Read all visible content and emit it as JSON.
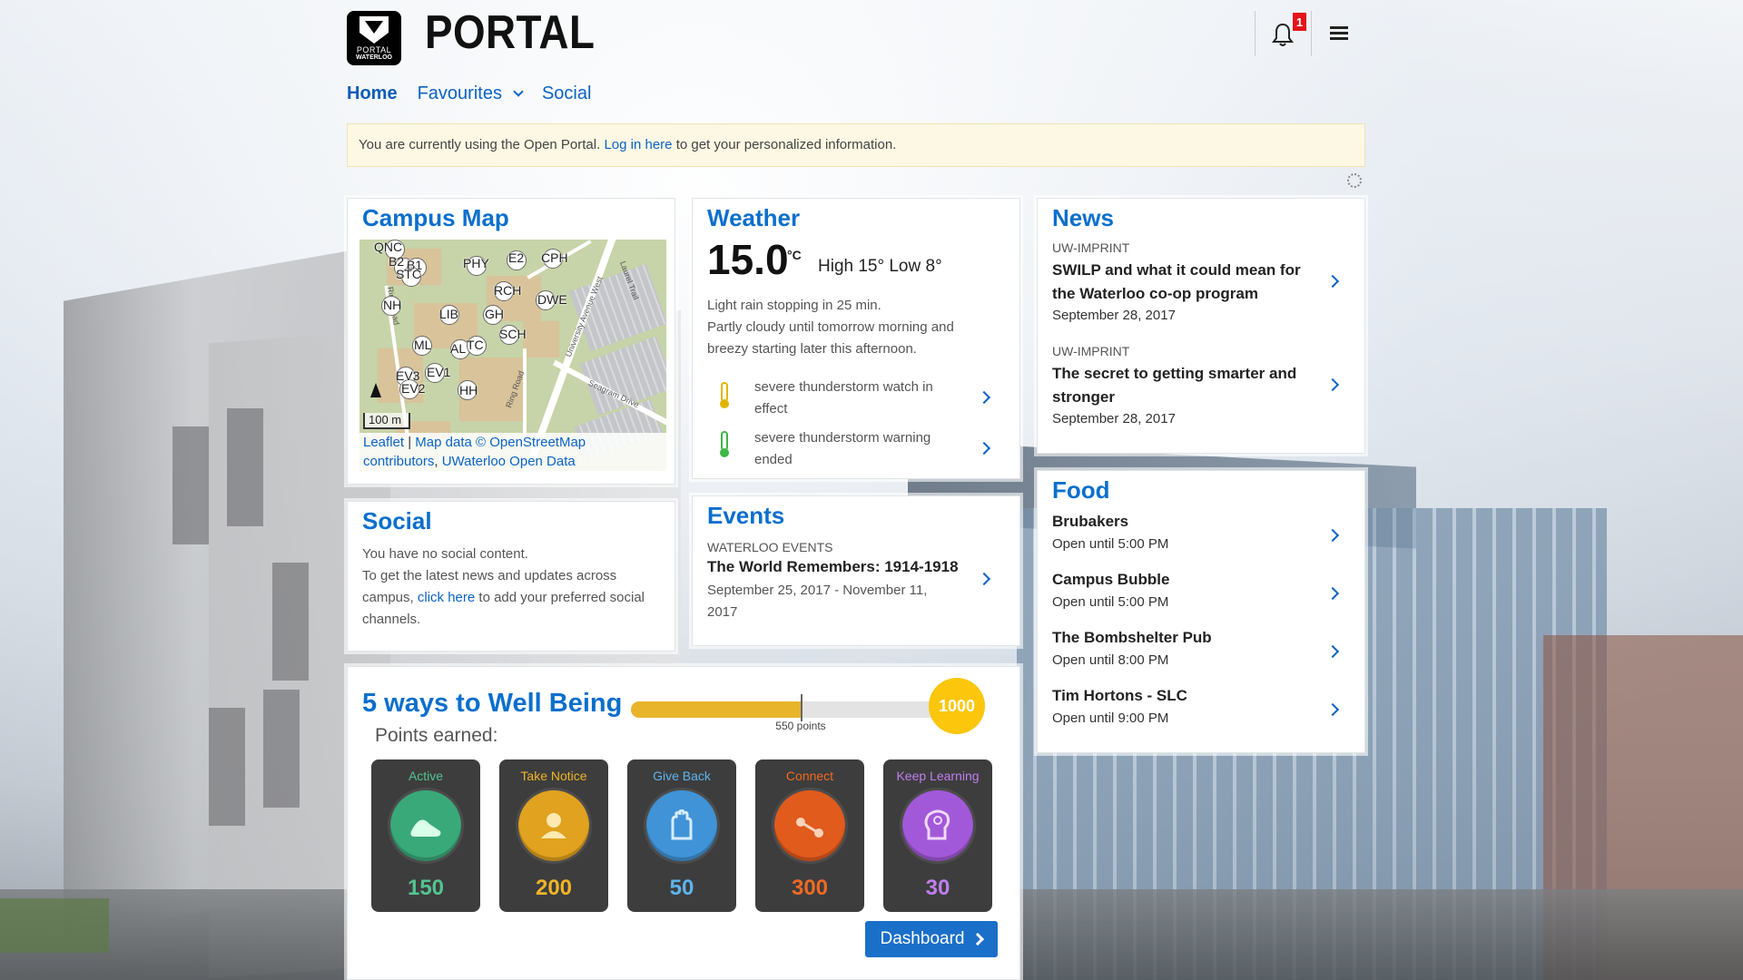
{
  "header": {
    "logo_text_1": "PORTAL",
    "logo_text_2": "WATERLOO",
    "title": "PORTAL",
    "notification_count": "1"
  },
  "nav": {
    "home": "Home",
    "favourites": "Favourites",
    "social": "Social"
  },
  "notice": {
    "before": "You are currently using the Open Portal.",
    "link": "Log in here",
    "after": "to get your personalized information."
  },
  "campus_map": {
    "title": "Campus Map",
    "pins": [
      "QNC",
      "B2",
      "B1",
      "STC",
      "PHY",
      "E2",
      "CPH",
      "RCH",
      "DWE",
      "NH",
      "LIB",
      "GH",
      "SCH",
      "ML",
      "AL",
      "TC",
      "EV1",
      "EV3",
      "EV2",
      "HH"
    ],
    "streets": [
      "University Avenue West",
      "Ring Road",
      "Ring Road",
      "Seagram Drive",
      "Laurel Trail"
    ],
    "scale": "100 m",
    "attrib_leaflet": "Leaflet",
    "attrib_sep": "|",
    "attrib_map": "Map data ©",
    "attrib_osm": "OpenStreetMap contributors",
    "attrib_comma": ",",
    "attrib_uw": "UWaterloo Open Data"
  },
  "weather": {
    "title": "Weather",
    "temp": "15.0",
    "unit": "°C",
    "hilo": "High 15° Low 8°",
    "desc_1": "Light rain stopping in 25 min.",
    "desc_2": "Partly cloudy until tomorrow morning and breezy starting later this afternoon.",
    "alerts": [
      {
        "text": "severe thunderstorm watch in effect",
        "color": "#e1b400"
      },
      {
        "text": "severe thunderstorm warning ended",
        "color": "#3db843"
      }
    ]
  },
  "news": {
    "title": "News",
    "items": [
      {
        "source": "UW-IMPRINT",
        "headline": "SWILP and what it could mean for the Waterloo co-op program",
        "date": "September 28, 2017"
      },
      {
        "source": "UW-IMPRINT",
        "headline": "The secret to getting smarter and stronger",
        "date": "September 28, 2017"
      }
    ]
  },
  "social": {
    "title": "Social",
    "line_1": "You have no social content.",
    "line_2_before": "To get the latest news and updates across campus,",
    "link": "click here",
    "line_2_after": "to add your preferred social channels."
  },
  "events": {
    "title": "Events",
    "source": "WATERLOO EVENTS",
    "name": "The World Remembers: 1914-1918",
    "dates": "September 25, 2017 - November 11, 2017"
  },
  "food": {
    "title": "Food",
    "items": [
      {
        "name": "Brubakers",
        "hours": "Open until 5:00 PM"
      },
      {
        "name": "Campus Bubble",
        "hours": "Open until 5:00 PM"
      },
      {
        "name": "The Bombshelter Pub",
        "hours": "Open until 8:00 PM"
      },
      {
        "name": "Tim Hortons - SLC",
        "hours": "Open until 9:00 PM"
      }
    ]
  },
  "wellbeing": {
    "title": "5 ways to Well Being",
    "points_label": "Points earned:",
    "progress_points": 550,
    "goal": "1000",
    "progress_label": "550 points",
    "categories": [
      {
        "label": "Active",
        "value": "150",
        "color": "#3aa97a",
        "label_color": "#53c48f"
      },
      {
        "label": "Take Notice",
        "value": "200",
        "color": "#e0a21f",
        "label_color": "#f0b428"
      },
      {
        "label": "Give Back",
        "value": "50",
        "color": "#3f93d6",
        "label_color": "#5eb3ee"
      },
      {
        "label": "Connect",
        "value": "300",
        "color": "#e05b1c",
        "label_color": "#ef6a22"
      },
      {
        "label": "Keep Learning",
        "value": "30",
        "color": "#a259d9",
        "label_color": "#c07ef0"
      }
    ],
    "dashboard_label": "Dashboard"
  }
}
